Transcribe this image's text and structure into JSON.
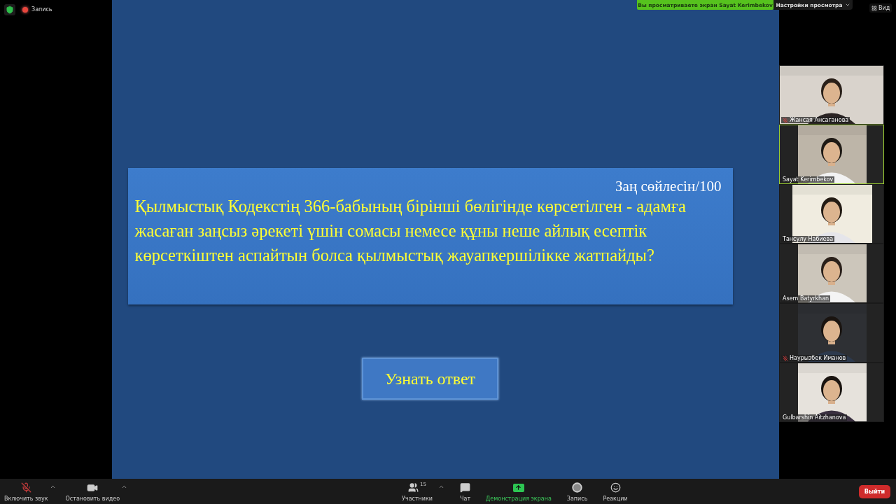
{
  "top_bar": {
    "recording_label": "Запись",
    "banner": "Вы просматриваете экран Sayat Kerimbekov",
    "view_options": "Настройки просмотра",
    "view_button": "Вид"
  },
  "slide": {
    "score": "Заң сөйлесін/100",
    "question": "Қылмыстық Кодекстің 366-бабының бірінші бөлігінде көрсетілген - адамға жасаған заңсыз әрекеті үшін сомасы немесе құны неше айлық есептік көрсеткіштен аспайтын болса қылмыстық жауапкершілікке жатпайды?",
    "answer_button": "Узнать ответ"
  },
  "participants": [
    {
      "name": "Жансая Ансаганова",
      "muted": true,
      "selected": false
    },
    {
      "name": "Sayat Kerimbekov",
      "muted": false,
      "selected": true
    },
    {
      "name": "Тансулу Набиева",
      "muted": false,
      "selected": false
    },
    {
      "name": "Asem Batyrkhan",
      "muted": false,
      "selected": false
    },
    {
      "name": "Наурызбек Иманов",
      "muted": true,
      "selected": false
    },
    {
      "name": "Gulbarshin Aitzhanova",
      "muted": false,
      "selected": false
    }
  ],
  "toolbar": {
    "left": [
      {
        "kind": "mic",
        "label": "Включить звук",
        "muted": true
      },
      {
        "kind": "video",
        "label": "Остановить видео"
      }
    ],
    "center": [
      {
        "kind": "participants",
        "label": "Участники",
        "count": "15"
      },
      {
        "kind": "chat",
        "label": "Чат"
      },
      {
        "kind": "share",
        "label": "Демонстрация экрана",
        "active": true
      },
      {
        "kind": "record",
        "label": "Запись"
      },
      {
        "kind": "reactions",
        "label": "Реакции"
      }
    ],
    "leave": "Выйти"
  }
}
